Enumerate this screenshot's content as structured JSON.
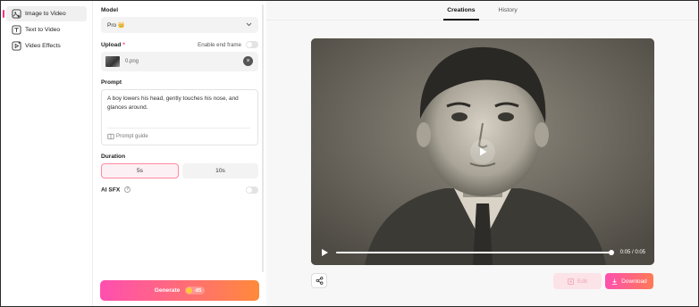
{
  "sidebar": {
    "items": [
      {
        "label": "Image to Video",
        "icon": "image-video-icon",
        "active": true
      },
      {
        "label": "Text to Video",
        "icon": "text-video-icon",
        "active": false
      },
      {
        "label": "Video Effects",
        "icon": "video-effects-icon",
        "active": false
      }
    ]
  },
  "panel": {
    "model_label": "Model",
    "model_value": "Pro 👑",
    "upload_label": "Upload",
    "upload_required": "*",
    "end_frame_label": "Enable end frame",
    "upload_filename": "0.png",
    "prompt_label": "Prompt",
    "prompt_text": "A boy lowers his head, gently touches his nose, and glances around.",
    "prompt_guide": "Prompt guide",
    "duration_label": "Duration",
    "duration_options": [
      "5s",
      "10s"
    ],
    "duration_selected": "5s",
    "ai_sfx_label": "AI SFX",
    "ai_sfx_info": "?",
    "generate_label": "Generate",
    "generate_cost": "-85"
  },
  "main": {
    "tabs": [
      "Creations",
      "History"
    ],
    "active_tab": "Creations",
    "video_time": "0:05 / 0:05",
    "video_progress": 1.0,
    "edit_label": "Edit",
    "download_label": "Download"
  },
  "colors": {
    "accent": "#ff2d86",
    "gradient_start": "#ff4fb0",
    "gradient_end": "#ff8a3a"
  }
}
